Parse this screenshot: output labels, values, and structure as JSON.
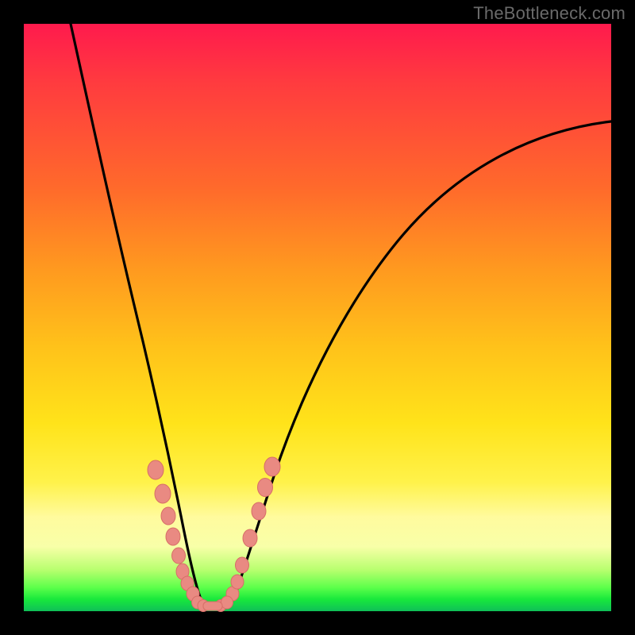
{
  "watermark": "TheBottleneck.com",
  "chart_data": {
    "type": "line",
    "title": "",
    "xlabel": "",
    "ylabel": "",
    "xlim": [
      0,
      100
    ],
    "ylim": [
      0,
      100
    ],
    "note": "Axes are unlabeled in the source image; values below are estimated in percent of plot extent, y=0 is the bottom (green) and y=100 is the top (red).",
    "series": [
      {
        "name": "left-arm",
        "x": [
          8,
          10,
          12,
          14,
          16,
          18,
          20,
          22,
          24,
          26,
          27,
          28,
          29
        ],
        "y": [
          100,
          86,
          73,
          61,
          50,
          40,
          31,
          22,
          14,
          7,
          4,
          2,
          1
        ]
      },
      {
        "name": "valley",
        "x": [
          29,
          30,
          31,
          32,
          33,
          34,
          35
        ],
        "y": [
          1,
          0.5,
          0.3,
          0.3,
          0.3,
          0.5,
          1
        ]
      },
      {
        "name": "right-arm",
        "x": [
          35,
          38,
          42,
          47,
          53,
          60,
          68,
          77,
          87,
          97
        ],
        "y": [
          1,
          8,
          20,
          34,
          47,
          58,
          67,
          74,
          79,
          83
        ]
      }
    ],
    "markers_left": {
      "note": "Pink ellipse markers on left arm, (x,y) in percent of plot extent.",
      "points": [
        [
          22.3,
          24.0
        ],
        [
          23.5,
          20.0
        ],
        [
          24.5,
          16.0
        ],
        [
          25.3,
          12.5
        ],
        [
          26.3,
          9.5
        ],
        [
          27.0,
          7.0
        ],
        [
          27.8,
          5.0
        ],
        [
          28.8,
          3.0
        ]
      ]
    },
    "markers_right": {
      "note": "Pink ellipse markers on right arm, (x,y) in percent of plot extent.",
      "points": [
        [
          35.5,
          3.0
        ],
        [
          36.3,
          5.0
        ],
        [
          37.2,
          8.0
        ],
        [
          38.5,
          12.5
        ],
        [
          40.0,
          17.0
        ],
        [
          41.0,
          21.0
        ],
        [
          42.3,
          24.5
        ]
      ]
    },
    "markers_valley": {
      "note": "Pink markers / short pink bar at the valley floor, (x,y) in percent of plot extent.",
      "points": [
        [
          29.5,
          1.5
        ],
        [
          30.5,
          1.0
        ],
        [
          33.5,
          1.0
        ],
        [
          34.5,
          1.5
        ]
      ],
      "bar": {
        "x1": 30.5,
        "x2": 33.8,
        "y": 0.8
      }
    },
    "colors": {
      "curve": "#000000",
      "marker_fill": "#e98a82",
      "marker_stroke": "#d76e67",
      "gradient_top": "#ff1a4d",
      "gradient_bottom": "#0fbf58"
    }
  }
}
